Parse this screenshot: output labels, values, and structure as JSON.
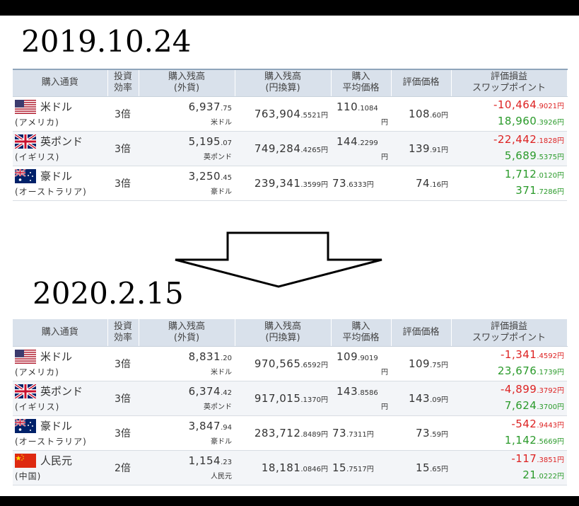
{
  "dates": {
    "before": "2019.10.24",
    "after": "2020.2.15"
  },
  "headers": {
    "currency": "購入通貨",
    "efficiency": [
      "投資",
      "効率"
    ],
    "balance_fc": [
      "購入残高",
      "(外貨)"
    ],
    "balance_jpy": [
      "購入残高",
      "(円換算)"
    ],
    "avg_price": [
      "購入",
      "平均価格"
    ],
    "eval_price": "評価価格",
    "pl": [
      "評価損益",
      "スワップポイント"
    ]
  },
  "yen": "円",
  "colors": {
    "header_bg": "#d9e1eb",
    "loss": "#dd2222",
    "gain": "#2a9a2a"
  },
  "table_before": [
    {
      "flag": "us-flag-icon",
      "name": "米ドル",
      "country": "(アメリカ)",
      "eff": "3倍",
      "fc_int": "6,937",
      "fc_dec": ".75",
      "fc_unit": "米ドル",
      "jpy_int": "763,904",
      "jpy_dec": ".5521",
      "avg_int": "110",
      "avg_dec": ".1084",
      "avg_wrap": true,
      "ev_int": "108",
      "ev_dec": ".60",
      "pl_int": "-10,464",
      "pl_dec": ".9021",
      "pl_color": "red",
      "sw_int": "18,960",
      "sw_dec": ".3926"
    },
    {
      "flag": "uk-flag-icon",
      "name": "英ポンド",
      "country": "(イギリス)",
      "eff": "3倍",
      "fc_int": "5,195",
      "fc_dec": ".07",
      "fc_unit": "英ポンド",
      "jpy_int": "749,284",
      "jpy_dec": ".4265",
      "avg_int": "144",
      "avg_dec": ".2299",
      "avg_wrap": true,
      "ev_int": "139",
      "ev_dec": ".91",
      "pl_int": "-22,442",
      "pl_dec": ".1828",
      "pl_color": "red",
      "sw_int": "5,689",
      "sw_dec": ".5375"
    },
    {
      "flag": "au-flag-icon",
      "name": "豪ドル",
      "country": "(オーストラリア)",
      "eff": "3倍",
      "fc_int": "3,250",
      "fc_dec": ".45",
      "fc_unit": "豪ドル",
      "jpy_int": "239,341",
      "jpy_dec": ".3599",
      "avg_int": "73",
      "avg_dec": ".6333",
      "avg_wrap": false,
      "ev_int": "74",
      "ev_dec": ".16",
      "pl_int": "1,712",
      "pl_dec": ".0120",
      "pl_color": "green",
      "sw_int": "371",
      "sw_dec": ".7286"
    }
  ],
  "table_after": [
    {
      "flag": "us-flag-icon",
      "name": "米ドル",
      "country": "(アメリカ)",
      "eff": "3倍",
      "fc_int": "8,831",
      "fc_dec": ".20",
      "fc_unit": "米ドル",
      "jpy_int": "970,565",
      "jpy_dec": ".6592",
      "avg_int": "109",
      "avg_dec": ".9019",
      "avg_wrap": true,
      "ev_int": "109",
      "ev_dec": ".75",
      "pl_int": "-1,341",
      "pl_dec": ".4592",
      "pl_color": "red",
      "sw_int": "23,676",
      "sw_dec": ".1739"
    },
    {
      "flag": "uk-flag-icon",
      "name": "英ポンド",
      "country": "(イギリス)",
      "eff": "3倍",
      "fc_int": "6,374",
      "fc_dec": ".42",
      "fc_unit": "英ポンド",
      "jpy_int": "917,015",
      "jpy_dec": ".1370",
      "avg_int": "143",
      "avg_dec": ".8586",
      "avg_wrap": true,
      "ev_int": "143",
      "ev_dec": ".09",
      "pl_int": "-4,899",
      "pl_dec": ".3792",
      "pl_color": "red",
      "sw_int": "7,624",
      "sw_dec": ".3700"
    },
    {
      "flag": "au-flag-icon",
      "name": "豪ドル",
      "country": "(オーストラリア)",
      "eff": "3倍",
      "fc_int": "3,847",
      "fc_dec": ".94",
      "fc_unit": "豪ドル",
      "jpy_int": "283,712",
      "jpy_dec": ".8489",
      "avg_int": "73",
      "avg_dec": ".7311",
      "avg_wrap": false,
      "ev_int": "73",
      "ev_dec": ".59",
      "pl_int": "-542",
      "pl_dec": ".9443",
      "pl_color": "red",
      "sw_int": "1,142",
      "sw_dec": ".5669"
    },
    {
      "flag": "cn-flag-icon",
      "name": "人民元",
      "country": "(中国)",
      "eff": "2倍",
      "fc_int": "1,154",
      "fc_dec": ".23",
      "fc_unit": "人民元",
      "jpy_int": "18,181",
      "jpy_dec": ".0846",
      "avg_int": "15",
      "avg_dec": ".7517",
      "avg_wrap": false,
      "ev_int": "15",
      "ev_dec": ".65",
      "pl_int": "-117",
      "pl_dec": ".3851",
      "pl_color": "red",
      "sw_int": "21",
      "sw_dec": ".0222"
    }
  ]
}
